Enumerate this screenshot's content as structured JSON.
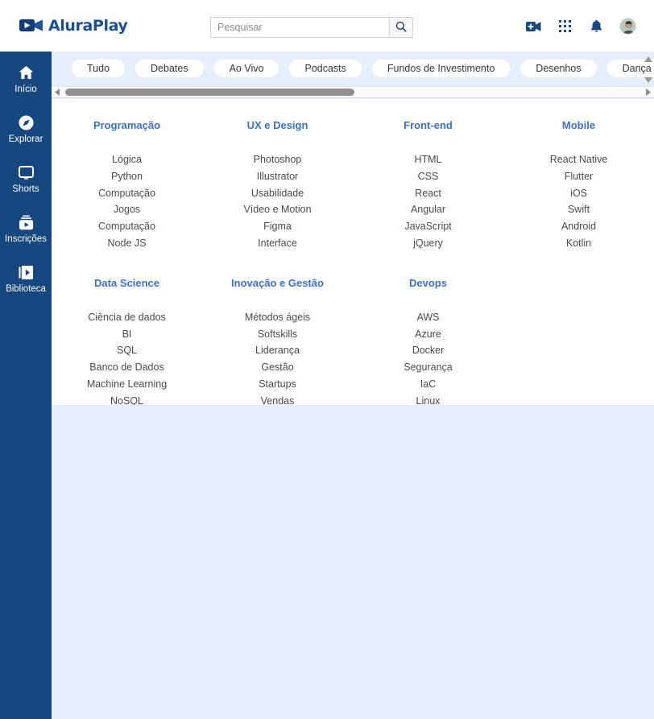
{
  "brand": {
    "name": "AluraPlay",
    "logo_icon": "video-camera-icon",
    "color": "#1b4f93"
  },
  "search": {
    "placeholder": "Pesquisar",
    "value": "",
    "button_icon": "search-icon"
  },
  "header_actions": [
    {
      "icon": "video-camera-plus-icon",
      "label": "Criar"
    },
    {
      "icon": "apps-grid-icon",
      "label": "Aplicativos"
    },
    {
      "icon": "bell-icon",
      "label": "Notificações"
    },
    {
      "icon": "avatar",
      "label": "Perfil"
    }
  ],
  "sidebar": {
    "items": [
      {
        "label": "Início",
        "icon": "home-icon"
      },
      {
        "label": "Explorar",
        "icon": "compass-icon"
      },
      {
        "label": "Shorts",
        "icon": "shorts-icon"
      },
      {
        "label": "Inscrições",
        "icon": "subscriptions-icon"
      },
      {
        "label": "Biblioteca",
        "icon": "library-icon"
      }
    ]
  },
  "chips": [
    "Tudo",
    "Debates",
    "Ao Vivo",
    "Podcasts",
    "Fundos de Investimento",
    "Desenhos",
    "Dança"
  ],
  "scrollbars": {
    "horizontal": {
      "left_arrow_icon": "triangle-left-icon",
      "right_arrow_icon": "triangle-right-icon",
      "thumb_percent": 50
    },
    "vertical": {
      "up_arrow_icon": "triangle-up-icon",
      "down_arrow_icon": "triangle-down-icon"
    }
  },
  "categories": [
    {
      "title": "Programação",
      "links": [
        "Lógica",
        "Python",
        "Computação",
        "Jogos",
        "Computação",
        "Node JS"
      ]
    },
    {
      "title": "UX e Design",
      "links": [
        "Photoshop",
        "Illustrator",
        "Usabilidade",
        "Vídeo e Motion",
        "Figma",
        "Interface"
      ]
    },
    {
      "title": "Front-end",
      "links": [
        "HTML",
        "CSS",
        "React",
        "Angular",
        "JavaScript",
        "jQuery"
      ]
    },
    {
      "title": "Mobile",
      "links": [
        "React Native",
        "Flutter",
        "iOS",
        "Swift",
        "Android",
        "Kotlin"
      ]
    },
    {
      "title": "Data Science",
      "links": [
        "Ciência de dados",
        "BI",
        "SQL",
        "Banco de Dados",
        "Machine Learning",
        "NoSQL"
      ]
    },
    {
      "title": "Inovação e Gestão",
      "links": [
        "Métodos ágeis",
        "Softskills",
        "Liderança",
        "Gestão",
        "Startups",
        "Vendas"
      ]
    },
    {
      "title": "Devops",
      "links": [
        "AWS",
        "Azure",
        "Docker",
        "Segurança",
        "IaC",
        "Linux"
      ]
    }
  ],
  "theme": {
    "page_bg": "#e4eefc",
    "sidebar_bg": "#17477f",
    "panel_bg": "#ffffff",
    "heading_color": "#3c6fc4",
    "link_color": "#4b4b4b"
  }
}
